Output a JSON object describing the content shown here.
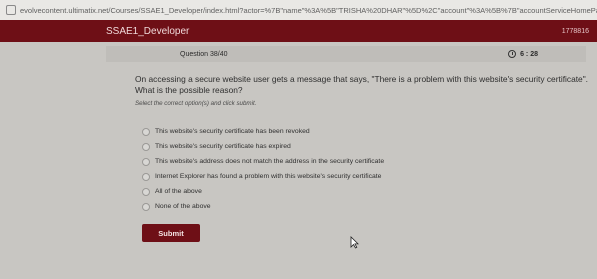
{
  "browser": {
    "url": "evolvecontent.ultimatix.net/Courses/SSAE1_Developer/index.html?actor=%7B\"name\"%3A%5B\"TRISHA%20DHAR\"%5D%2C\"account\"%3A%5B%7B\"accountServiceHomePage\"%3A\"https%3"
  },
  "header": {
    "title": "SSAE1_Developer",
    "id": "1778816"
  },
  "quiz": {
    "counter": "Question 38/40",
    "timer": "6 : 28",
    "question": "On accessing a secure website user gets a message that says, \"There is a problem with this website's security certificate\". What is the possible reason?",
    "instruction": "Select the correct option(s) and click submit.",
    "options": [
      "This website's security certificate has been revoked",
      "This website's security certificate has expired",
      "This website's address does not match the address in the security certificate",
      "Internet Explorer has found a problem with this website's security certificate",
      "All of the above",
      "None of the above"
    ],
    "submit_label": "Submit"
  },
  "icons": {
    "timer": "clock-icon",
    "url": "page-icon",
    "cursor": "mouse-pointer-icon"
  },
  "colors": {
    "accent": "#6e0f16",
    "background": "#c8c6c2"
  }
}
